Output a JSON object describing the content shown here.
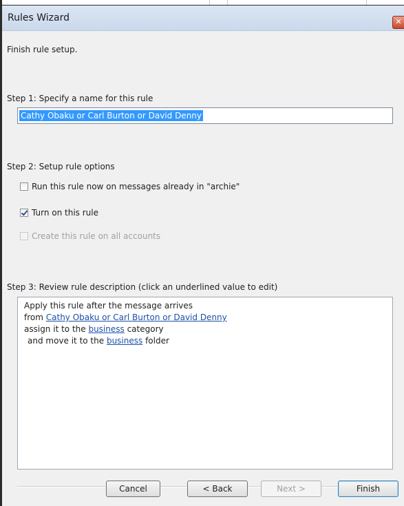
{
  "window": {
    "title": "Rules Wizard",
    "close_glyph": "✕"
  },
  "heading": "Finish rule setup.",
  "step1": {
    "label": "Step 1: Specify a name for this rule",
    "name_value": "Cathy Obaku or Carl Burton or David Denny"
  },
  "step2": {
    "label": "Step 2: Setup rule options",
    "options": [
      {
        "label": "Run this rule now on messages already in \"archie\"",
        "checked": false,
        "enabled": true
      },
      {
        "label": "Turn on this rule",
        "checked": true,
        "enabled": true
      },
      {
        "label": "Create this rule on all accounts",
        "checked": false,
        "enabled": false
      }
    ]
  },
  "step3": {
    "label": "Step 3: Review rule description (click an underlined value to edit)",
    "line1": "Apply this rule after the message arrives",
    "line2_prefix": "from ",
    "line2_link": "Cathy Obaku or Carl Burton or David Denny",
    "line3_prefix": "assign it to the ",
    "line3_link": "business",
    "line3_suffix": " category",
    "line4_prefix": "  and move it to the ",
    "line4_link": "business",
    "line4_suffix": " folder"
  },
  "buttons": {
    "cancel": "Cancel",
    "back": "< Back",
    "next": "Next >",
    "finish": "Finish"
  }
}
